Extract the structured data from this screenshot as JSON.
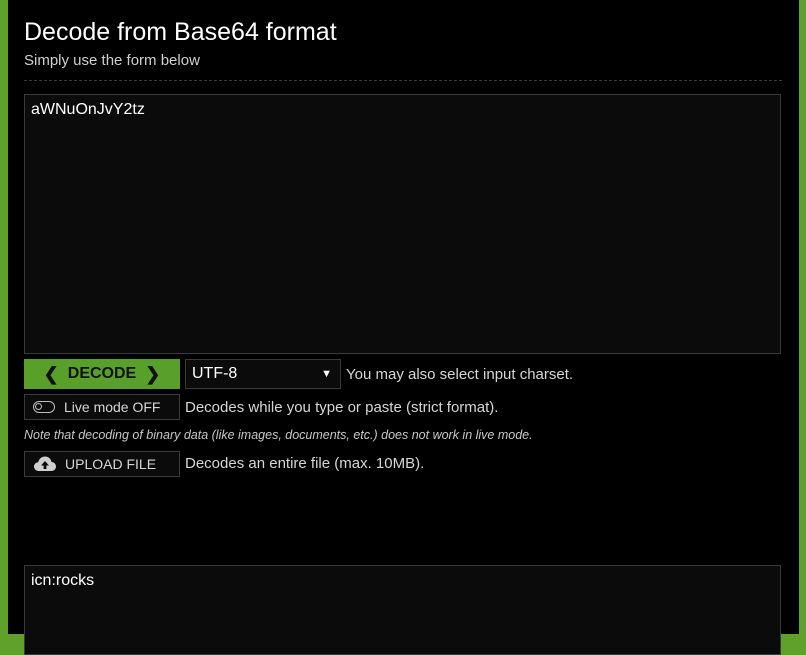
{
  "header": {
    "title": "Decode from Base64 format",
    "subtitle": "Simply use the form below"
  },
  "input": {
    "value": "aWNuOnJvY2tz"
  },
  "controls": {
    "decode_label": "DECODE",
    "charset_value": "UTF-8",
    "charset_hint": "You may also select input charset.",
    "live_mode_label": "Live mode OFF",
    "live_mode_hint": "Decodes while you type or paste (strict format).",
    "note": "Note that decoding of binary data (like images, documents, etc.) does not work in live mode.",
    "upload_label": "UPLOAD FILE",
    "upload_hint": "Decodes an entire file (max. 10MB)."
  },
  "output": {
    "value": "icn:rocks"
  },
  "colors": {
    "accent": "#58a02a",
    "background": "#000000",
    "border": "#3a3a3a"
  },
  "icons": {
    "decode_left": "chevron-left-icon",
    "decode_right": "chevron-right-icon",
    "dropdown": "caret-down-icon",
    "live_mode": "toggle-icon",
    "upload": "cloud-upload-icon"
  }
}
